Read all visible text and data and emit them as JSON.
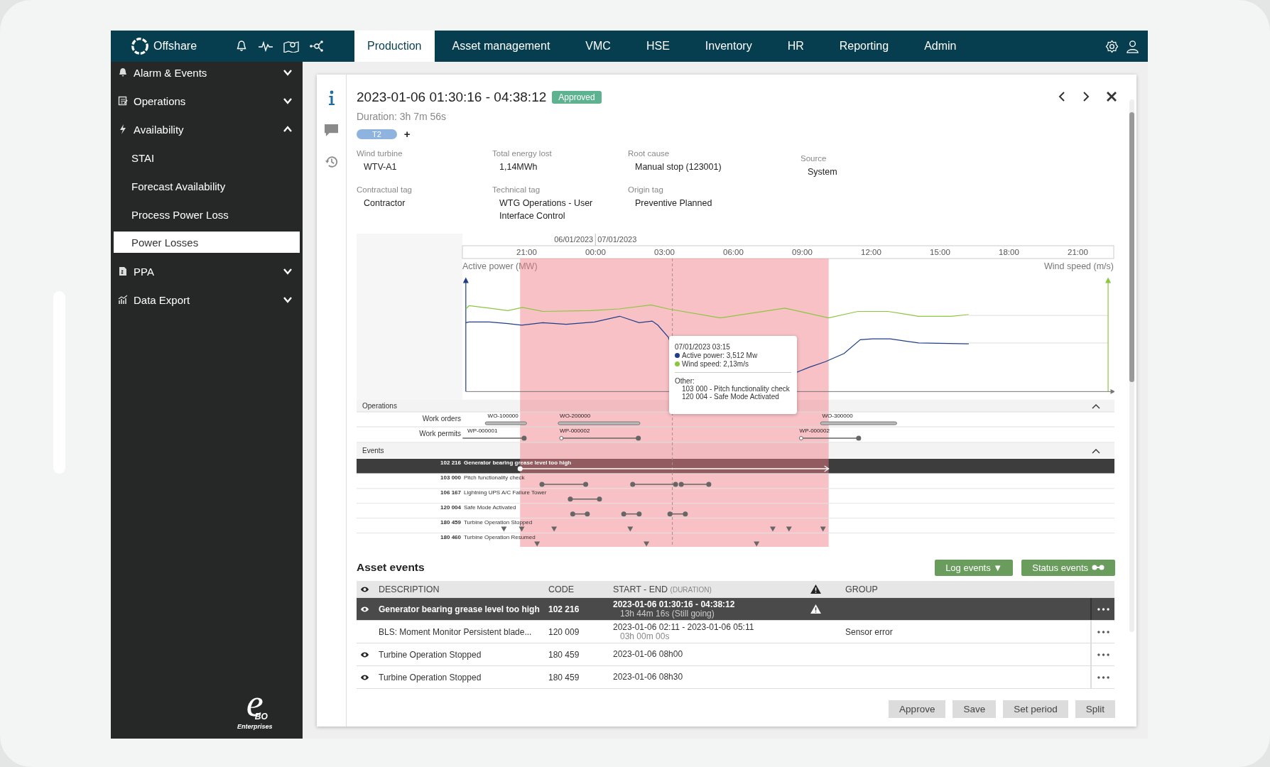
{
  "nav": {
    "brand": "Offshare",
    "tabs": [
      {
        "label": "Production",
        "selected": true
      },
      {
        "label": "Asset management",
        "selected": false
      },
      {
        "label": "VMC",
        "selected": false
      },
      {
        "label": "HSE",
        "selected": false
      },
      {
        "label": "Inventory",
        "selected": false
      },
      {
        "label": "HR",
        "selected": false
      },
      {
        "label": "Reporting",
        "selected": false
      },
      {
        "label": "Admin",
        "selected": false
      }
    ]
  },
  "sidebar": {
    "items": [
      {
        "label": "Alarm & Events",
        "expanded": false
      },
      {
        "label": "Operations",
        "expanded": false
      },
      {
        "label": "Availability",
        "expanded": true,
        "children": [
          {
            "label": "STAI",
            "selected": false
          },
          {
            "label": "Forecast Availability",
            "selected": false
          },
          {
            "label": "Process Power Loss",
            "selected": false
          },
          {
            "label": "Power Losses",
            "selected": true
          }
        ]
      },
      {
        "label": "PPA",
        "expanded": false
      },
      {
        "label": "Data Export",
        "expanded": false
      }
    ],
    "brand": {
      "mark": "e",
      "sub": "BO",
      "caption": "Enterprises"
    }
  },
  "card": {
    "side_tabs": [
      {
        "selected": true
      },
      {
        "selected": false
      },
      {
        "selected": false
      }
    ],
    "title": "2023-01-06 01:30:16 - 04:38:12",
    "status": "Approved",
    "duration": "Duration: 3h 7m 56s",
    "tags": [
      {
        "label": "T2"
      }
    ],
    "add_tag": "+",
    "fields": [
      {
        "label": "Wind turbine",
        "value": "WTV-A1"
      },
      {
        "label": "Total energy lost",
        "value": "1,14MWh"
      },
      {
        "label": "Root cause",
        "value": "Manual stop (123001)"
      },
      {
        "label": "Source",
        "value": "System"
      },
      {
        "label": "Contractual tag",
        "value": "Contractor"
      },
      {
        "label": "Technical tag",
        "value": "WTG Operations - User Interface Control"
      },
      {
        "label": "Origin tag",
        "value": "Preventive Planned"
      }
    ]
  },
  "timeline": {
    "dates": [
      "06/01/2023",
      "07/01/2023"
    ],
    "ticks": [
      "21:00",
      "00:00",
      "03:00",
      "06:00",
      "09:00",
      "12:00",
      "15:00",
      "18:00",
      "21:00"
    ],
    "left_axis": "Active power (MW)",
    "right_axis": "Wind speed (m/s)",
    "tooltip": {
      "time": "07/01/2023 03:15",
      "series": [
        {
          "label": "Active power: 3,512 Mw",
          "color": "#1f3d8a"
        },
        {
          "label": "Wind speed: 2,13m/s",
          "color": "#8cc63f"
        }
      ],
      "other_title": "Other:",
      "other": [
        "103 000 - Pitch functionality check",
        "120 004 - Safe Mode Activated"
      ]
    },
    "operations": {
      "title": "Operations",
      "rows": [
        {
          "label": "Work orders",
          "items": [
            "WO-100000",
            "WO-200000",
            "WO-300000"
          ]
        },
        {
          "label": "Work permits",
          "items": [
            "WP-000001",
            "WP-000002",
            "WP-000002"
          ]
        }
      ]
    },
    "events": {
      "title": "Events",
      "rows": [
        {
          "code": "102 216",
          "name": "Generator bearing grease level too high",
          "selected": true
        },
        {
          "code": "103 000",
          "name": "Pitch functionality check",
          "selected": false
        },
        {
          "code": "106 167",
          "name": "Lightning UPS A/C Failure Tower",
          "selected": false
        },
        {
          "code": "120 004",
          "name": "Safe Mode Activated",
          "selected": false
        },
        {
          "code": "180 459",
          "name": "Turbine Operation Stopped",
          "selected": false
        },
        {
          "code": "180 460",
          "name": "Turbine Operation Resumed",
          "selected": false
        }
      ]
    }
  },
  "asset_events": {
    "title": "Asset events",
    "log_button": "Log events ▼",
    "status_button": "Status events",
    "columns": {
      "description": "DESCRIPTION",
      "code": "CODE",
      "start_end": "START - END",
      "duration": "(DURATION)",
      "group": "GROUP"
    },
    "rows": [
      {
        "visible": true,
        "selected": true,
        "warning": true,
        "description": "Generator bearing grease level too high",
        "code": "102 216",
        "period": "2023-01-06 01:30:16 - 04:38:12",
        "duration": "13h 44m 16s (Still going)"
      },
      {
        "visible": false,
        "selected": false,
        "warning": false,
        "description": "BLS: Moment Monitor Persistent blade...",
        "code": "120 009",
        "period": "2023-01-06 02:11 - 2023-01-06 05:11",
        "duration": "03h 00m 00s",
        "group": "Sensor error"
      },
      {
        "visible": true,
        "selected": false,
        "warning": false,
        "description": "Turbine Operation Stopped",
        "code": "180 459",
        "period": "2023-01-06 08h00"
      },
      {
        "visible": true,
        "selected": false,
        "warning": false,
        "description": "Turbine Operation Stopped",
        "code": "180 459",
        "period": "2023-01-06 08h30"
      }
    ],
    "actions": [
      "Approve",
      "Save",
      "Set period",
      "Split"
    ]
  }
}
